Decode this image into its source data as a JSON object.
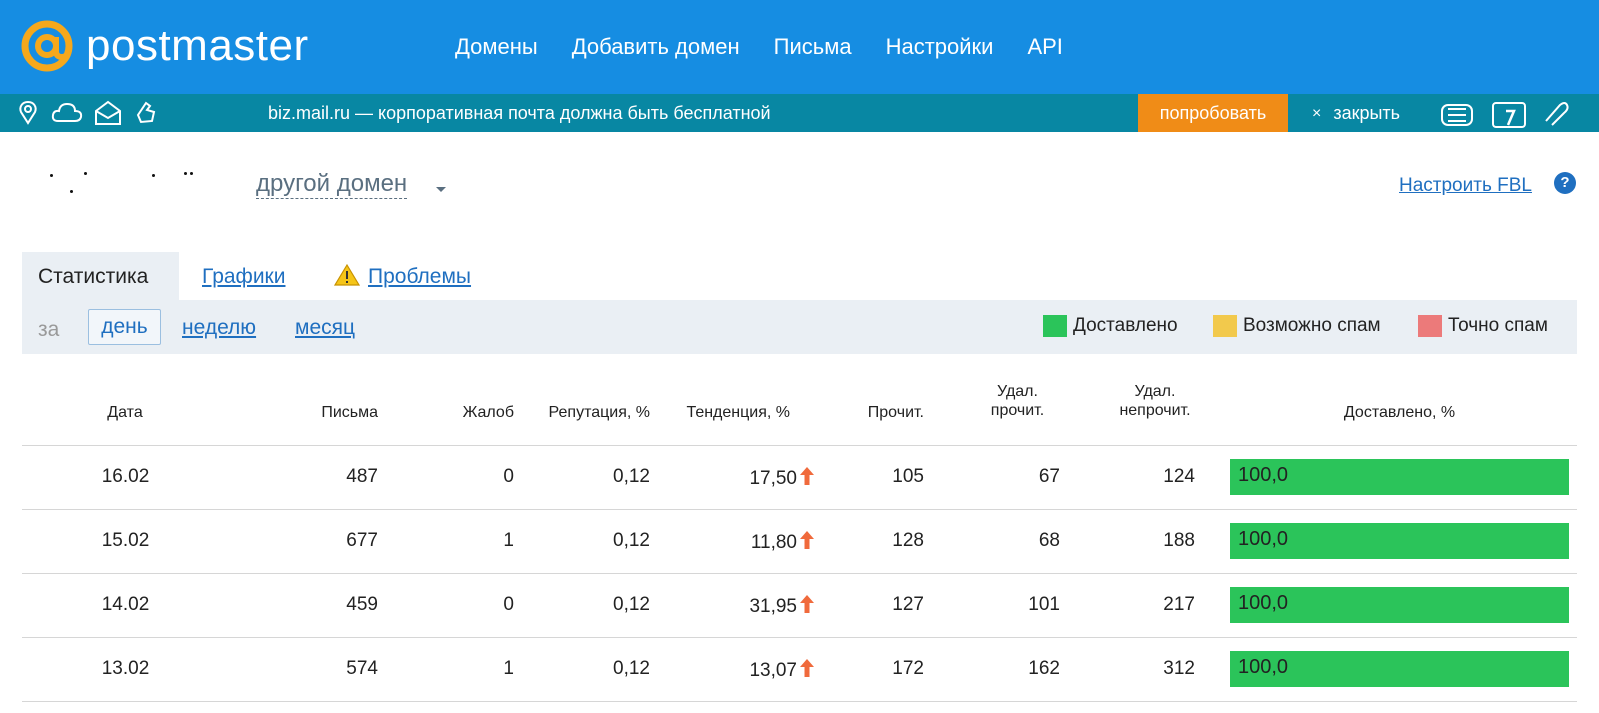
{
  "header": {
    "logo_text": "postmaster",
    "nav": [
      "Домены",
      "Добавить домен",
      "Письма",
      "Настройки",
      "API"
    ]
  },
  "promo": {
    "text": "biz.mail.ru — корпоративная почта должна быть бесплатной",
    "try_label": "попробовать",
    "close_label": "закрыть",
    "close_glyph": "×",
    "button_color": "#f08c17"
  },
  "domain": {
    "other_domain_label": "другой домен",
    "fbl_link": "Настроить FBL",
    "help_glyph": "?"
  },
  "tabs": {
    "stats": "Статистика",
    "charts": "Графики",
    "problems": "Проблемы"
  },
  "filter": {
    "prefix": "за",
    "periods": [
      "день",
      "неделю",
      "месяц"
    ],
    "active_period": "день"
  },
  "legend": [
    {
      "label": "Доставлено",
      "color": "#2bc45a"
    },
    {
      "label": "Возможно спам",
      "color": "#f2c94c"
    },
    {
      "label": "Точно спам",
      "color": "#ec7a7a"
    }
  ],
  "table": {
    "columns": {
      "date": "Дата",
      "letters": "Письма",
      "complaints": "Жалоб",
      "reputation": "Репутация, %",
      "trend": "Тенденция, %",
      "read": "Прочит.",
      "del_read_1": "Удал.",
      "del_read_2": "прочит.",
      "del_unread_1": "Удал.",
      "del_unread_2": "непрочит.",
      "delivered": "Доставлено, %"
    },
    "rows": [
      {
        "date": "16.02",
        "letters": "487",
        "complaints": "0",
        "reputation": "0,12",
        "trend": "17,50",
        "read": "105",
        "del_read": "67",
        "del_unread": "124",
        "delivered": "100,0",
        "delivered_pct": 100
      },
      {
        "date": "15.02",
        "letters": "677",
        "complaints": "1",
        "reputation": "0,12",
        "trend": "11,80",
        "read": "128",
        "del_read": "68",
        "del_unread": "188",
        "delivered": "100,0",
        "delivered_pct": 100
      },
      {
        "date": "14.02",
        "letters": "459",
        "complaints": "0",
        "reputation": "0,12",
        "trend": "31,95",
        "read": "127",
        "del_read": "101",
        "del_unread": "217",
        "delivered": "100,0",
        "delivered_pct": 100
      },
      {
        "date": "13.02",
        "letters": "574",
        "complaints": "1",
        "reputation": "0,12",
        "trend": "13,07",
        "read": "172",
        "del_read": "162",
        "del_unread": "312",
        "delivered": "100,0",
        "delivered_pct": 100
      }
    ],
    "trend_up_color": "#f06a3c"
  },
  "colors": {
    "header_bg": "#168de2",
    "promo_bg": "#0887a3",
    "link": "#1f6fc0",
    "logo_accent": "#f6a81c"
  }
}
